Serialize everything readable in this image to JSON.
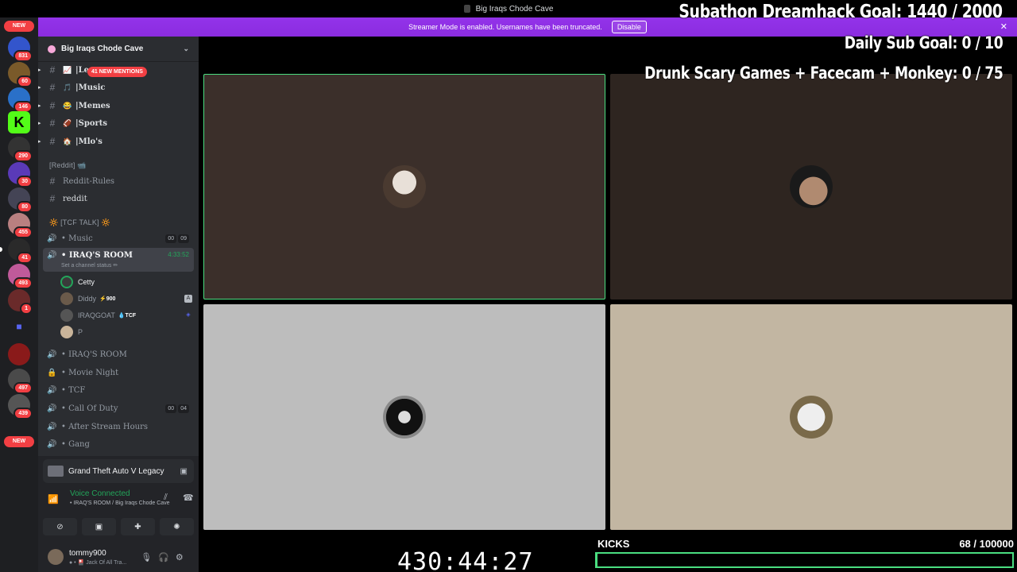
{
  "window": {
    "title": "Big Iraqs Chode Cave"
  },
  "banner": {
    "text": "Streamer Mode is enabled. Usernames have been truncated.",
    "button": "Disable"
  },
  "rail": {
    "new_top": "NEW",
    "new_bottom": "NEW",
    "badges": [
      "831",
      "60",
      "146",
      "290",
      "30",
      "80",
      "455",
      "41",
      "493",
      "1",
      "497",
      "439"
    ]
  },
  "server": {
    "name": "Big Iraqs Chode Cave",
    "mentions": "41 NEW MENTIONS"
  },
  "channels": [
    {
      "emoji": "📈",
      "name": "|Le"
    },
    {
      "emoji": "🎵",
      "name": "|Music"
    },
    {
      "emoji": "😂",
      "name": "|Memes"
    },
    {
      "emoji": "🏈",
      "name": "|Sports"
    },
    {
      "emoji": "🏠",
      "name": "|Mlo's"
    }
  ],
  "cat_reddit": "[Reddit] 📹",
  "reddit_channels": [
    "Reddit-Rules",
    "reddit"
  ],
  "cat_tcf": "🔆 [TCF TALK] 🔆",
  "voice": {
    "music": {
      "name": "• Music",
      "c1": "00",
      "c2": "09"
    },
    "iraqs_room": {
      "name": "• IRAQ'S ROOM",
      "timer": "4:33:52",
      "status": "Set a channel status ✏"
    },
    "users": [
      {
        "name": "Cetty",
        "tag": "",
        "icon": ""
      },
      {
        "name": "Diddy",
        "tag": "⚡900",
        "icon": "A"
      },
      {
        "name": "IRAQGOAT",
        "tag": "💧TCF",
        "icon": "◈"
      },
      {
        "name": "P",
        "tag": "",
        "icon": ""
      }
    ],
    "others": [
      {
        "name": "• IRAQ'S ROOM",
        "lock": false
      },
      {
        "name": "• Movie Night",
        "lock": true
      },
      {
        "name": "• TCF",
        "lock": false
      },
      {
        "name": "• Call Of Duty",
        "lock": false,
        "c1": "00",
        "c2": "04"
      },
      {
        "name": "• After Stream Hours",
        "lock": false
      },
      {
        "name": "• Gang",
        "lock": false
      }
    ]
  },
  "activity": {
    "game": "Grand Theft Auto V Legacy"
  },
  "voice_connected": {
    "title": "Voice Connected",
    "sub": "• IRAQ'S ROOM / Big Iraqs Chode Cave"
  },
  "me": {
    "name": "tommy900",
    "status": "● • 🎴 Jack Of All Tra..."
  },
  "overlay": {
    "goal1": "Subathon Dreamhack Goal:  1440 / 2000",
    "goal2": "Daily Sub Goal:  0 / 10",
    "goal3": "Drunk Scary Games + Facecam + Monkey:  0 / 75",
    "timer": "430:44:27",
    "kicks_label": "KICKS",
    "kicks_count": "68  / 100000",
    "kicks_progress": 0.00068
  },
  "colors": {
    "banner": "#9333ea",
    "speaking": "#4ade80",
    "badge": "#f23f43"
  }
}
